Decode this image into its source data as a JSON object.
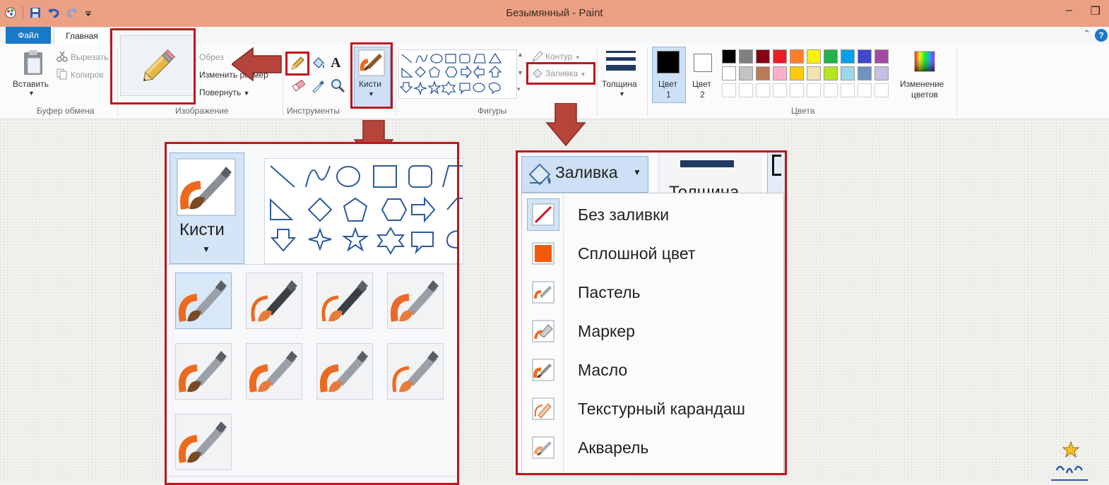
{
  "window": {
    "title": "Безымянный - Paint"
  },
  "tabs": {
    "file": "Файл",
    "home": "Главная"
  },
  "ribbon": {
    "clipboard": {
      "paste": "Вставить",
      "cut": "Вырезать",
      "copy": "Копиров",
      "group": "Буфер обмена"
    },
    "image": {
      "crop": "Обрез",
      "resize": "Изменить размер",
      "rotate": "Повернуть",
      "group": "Изображение"
    },
    "tools": {
      "text_glyph": "A",
      "group": "Инструменты"
    },
    "brushes": {
      "label": "Кисти"
    },
    "shapes": {
      "outline": "Контур",
      "fill": "Заливка",
      "group": "Фигуры"
    },
    "size": {
      "label": "Толщина"
    },
    "colors": {
      "color1": "Цвет",
      "color1_num": "1",
      "color2": "Цвет",
      "color2_num": "2",
      "edit": "Изменение",
      "edit2": "цветов",
      "group": "Цвета",
      "palette_row1": [
        "#000000",
        "#7f7f7f",
        "#880015",
        "#ed1c24",
        "#ff7f27",
        "#fff200",
        "#22b14c",
        "#00a2e8",
        "#3f48cc",
        "#a349a4"
      ],
      "palette_row2": [
        "#ffffff",
        "#c3c3c3",
        "#b97a57",
        "#ffaec9",
        "#ffc90e",
        "#efe4b0",
        "#b5e61d",
        "#99d9ea",
        "#7092be",
        "#c8bfe7"
      ],
      "color1_value": "#000000",
      "color2_value": "#ffffff"
    }
  },
  "brushes_panel": {
    "label": "Кисти"
  },
  "fill_menu": {
    "button": "Заливка",
    "size_label": "Толщина",
    "items": [
      "Без заливки",
      "Сплошной цвет",
      "Пастель",
      "Маркер",
      "Масло",
      "Текстурный карандаш",
      "Акварель"
    ]
  },
  "colors": {
    "highlight": "#c0151c",
    "arrow": "#b5443b",
    "titlebar": "#eba083",
    "accent": "#1979ca"
  }
}
